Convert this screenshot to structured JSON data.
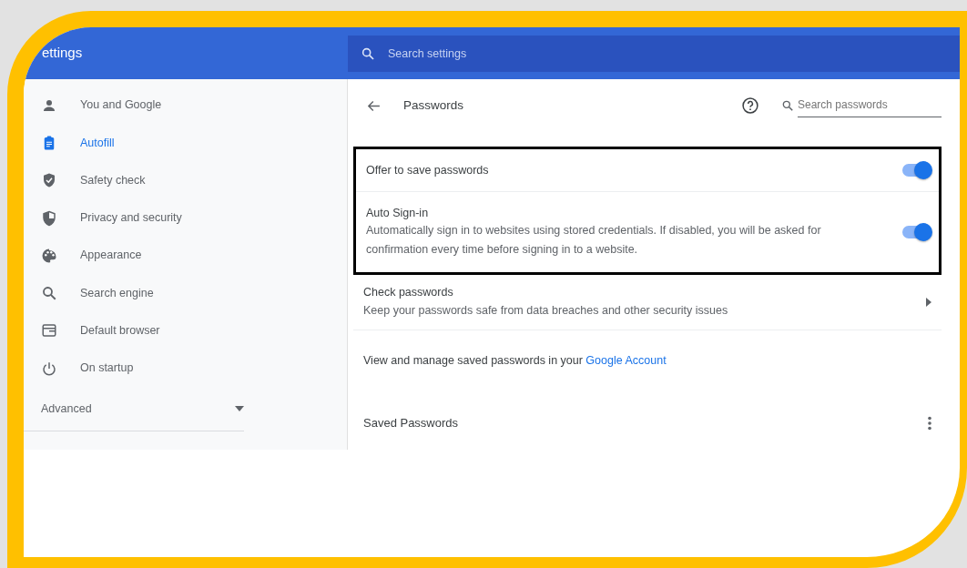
{
  "header": {
    "title": "ettings",
    "search_placeholder": "Search settings"
  },
  "sidebar": {
    "items": [
      {
        "label": "You and Google",
        "selected": false
      },
      {
        "label": "Autofill",
        "selected": true
      },
      {
        "label": "Safety check",
        "selected": false
      },
      {
        "label": "Privacy and security",
        "selected": false
      },
      {
        "label": "Appearance",
        "selected": false
      },
      {
        "label": "Search engine",
        "selected": false
      },
      {
        "label": "Default browser",
        "selected": false
      },
      {
        "label": "On startup",
        "selected": false
      }
    ],
    "advanced": {
      "label": "Advanced",
      "expanded": false
    }
  },
  "page": {
    "title": "Passwords",
    "search_placeholder": "Search passwords",
    "highlighted_settings": [
      {
        "title": "Offer to save passwords",
        "on": true
      },
      {
        "title": "Auto Sign-in",
        "description": "Automatically sign in to websites using stored credentials. If disabled, you will be asked for confirmation every time before signing in to a website.",
        "on": true
      }
    ],
    "check": {
      "title": "Check passwords",
      "description": "Keep your passwords safe from data breaches and other security issues"
    },
    "manage": {
      "text": "View and manage saved passwords in your",
      "link": "Google Account"
    },
    "saved_title": "Saved Passwords"
  }
}
